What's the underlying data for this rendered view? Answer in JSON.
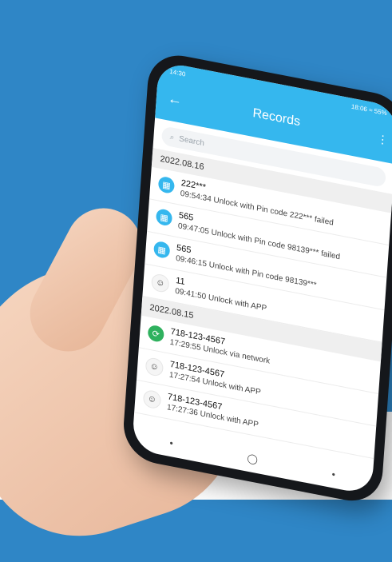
{
  "status_bar": {
    "time": "14:30",
    "right": "18:06 ≈ 55%"
  },
  "app": {
    "title": "Records",
    "search_placeholder": "Search"
  },
  "records": [
    {
      "date": "2022.08.16",
      "items": [
        {
          "icon": "pin-pad-icon",
          "name": "222***",
          "desc": "09:54:34 Unlock with Pin code 222*** failed"
        },
        {
          "icon": "pin-pad-icon",
          "name": "565",
          "desc": "09:47:05 Unlock with Pin code 98139*** failed"
        },
        {
          "icon": "pin-pad-icon",
          "name": "565",
          "desc": "09:46:15 Unlock with Pin code 98139***"
        },
        {
          "icon": "user-avatar-icon",
          "name": "11",
          "desc": "09:41:50 Unlock with APP"
        }
      ]
    },
    {
      "date": "2022.08.15",
      "items": [
        {
          "icon": "network-icon",
          "name": "718-123-4567",
          "desc": "17:29:55 Unlock via network"
        },
        {
          "icon": "user-avatar-icon",
          "name": "718-123-4567",
          "desc": "17:27:54 Unlock with APP"
        },
        {
          "icon": "user-avatar-icon",
          "name": "718-123-4567",
          "desc": "17:27:36 Unlock with APP"
        }
      ]
    }
  ],
  "nav_icons": [
    "recent-apps-icon",
    "home-icon",
    "back-nav-icon"
  ],
  "colors": {
    "background": "#2f86c6",
    "appbar": "#35b7ee",
    "network": "#2fb15e",
    "skin": "#f0c8ae",
    "phone_frame": "#15171b"
  }
}
